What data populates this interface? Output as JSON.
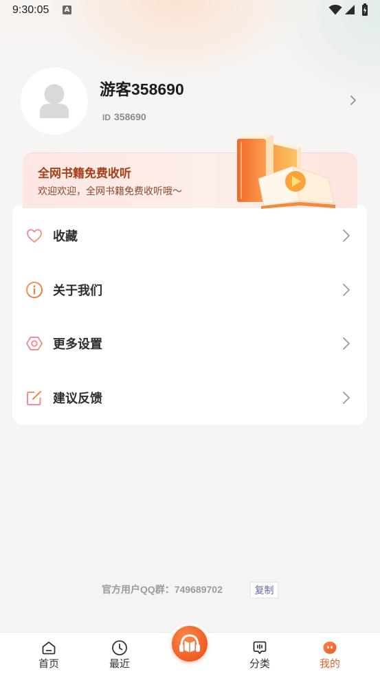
{
  "status_bar": {
    "time": "9:30:05",
    "notification_glyph": "A",
    "icons": [
      "a-notification-icon",
      "wifi-icon",
      "signal-icon",
      "battery-charging-icon"
    ]
  },
  "profile": {
    "avatar_icon": "default-avatar-icon",
    "name": "游客358690",
    "id_label": "ID",
    "id_value": "358690",
    "chevron_icon": "chevron-right-icon"
  },
  "banner": {
    "title": "全网书籍免费收听",
    "subtitle": "欢迎欢迎，全网书籍免费收听哦～",
    "illustration": "books-play-illustration"
  },
  "menu": [
    {
      "icon": "heart-icon",
      "label": "收藏"
    },
    {
      "icon": "info-icon",
      "label": "关于我们"
    },
    {
      "icon": "hexagon-settings-icon",
      "label": "更多设置"
    },
    {
      "icon": "edit-icon",
      "label": "建议反馈"
    }
  ],
  "footer": {
    "qq_group_text": "官方用户QQ群：749689702",
    "copy_label": "复制"
  },
  "tab_bar": {
    "items": [
      {
        "label": "首页",
        "icon": "home-icon",
        "active": false
      },
      {
        "label": "最近",
        "icon": "clock-icon",
        "active": false
      },
      {
        "label": "分类",
        "icon": "category-icon",
        "active": false
      },
      {
        "label": "我的",
        "icon": "profile-blob-icon",
        "active": true
      }
    ],
    "center_button_icon": "headphones-book-icon"
  },
  "colors": {
    "accent": "#e8652a",
    "banner_title": "#a3401a",
    "banner_subtitle": "#8d4a2c",
    "text_primary": "#2e2e2e",
    "text_secondary": "#9b9b9b",
    "copy_link": "#5b6da6",
    "card_background": "#ffffff",
    "page_background": "#f5f5f5"
  }
}
